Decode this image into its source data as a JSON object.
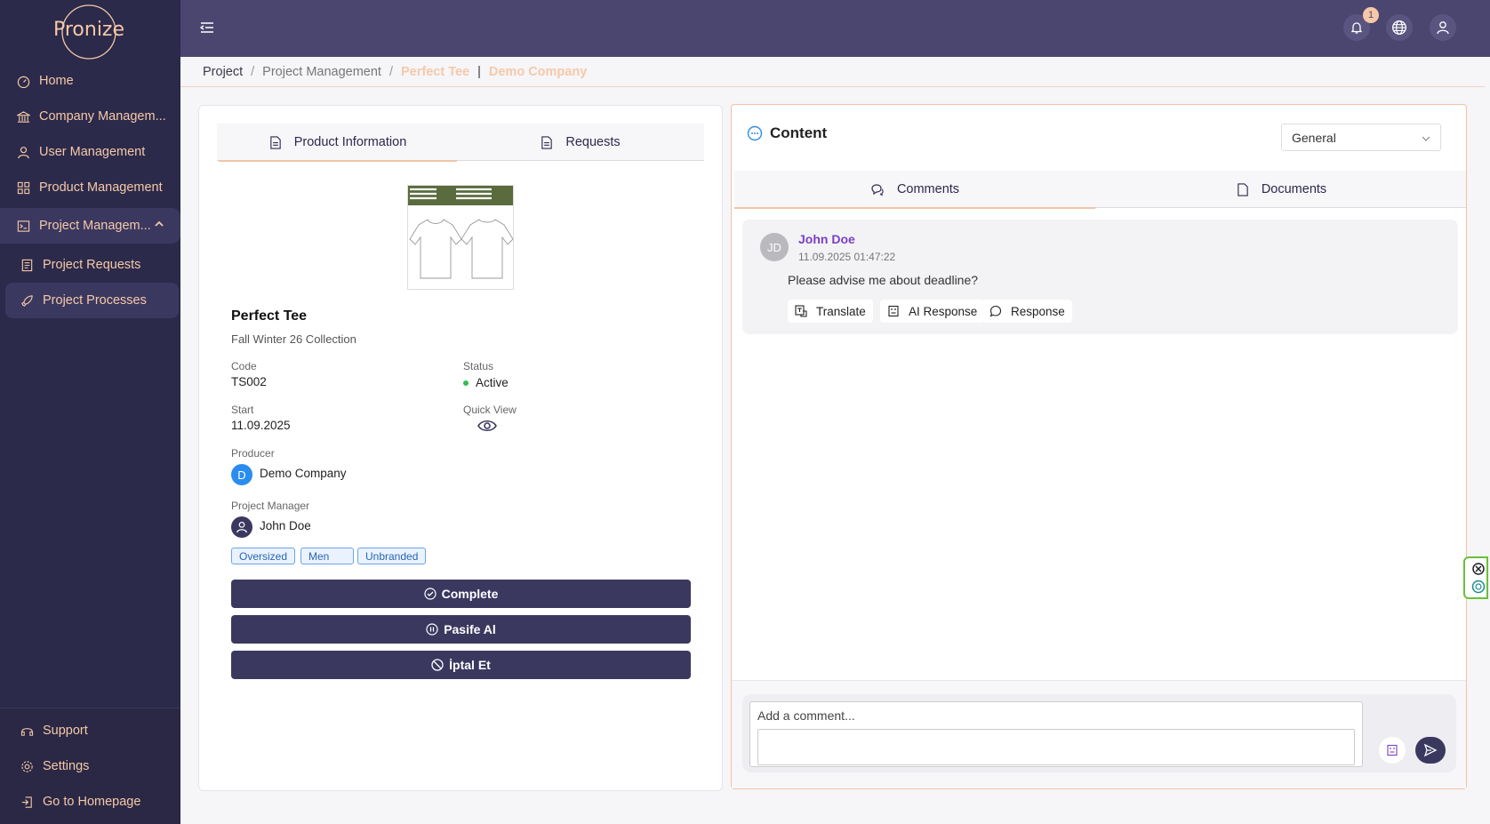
{
  "brand": {
    "logo": "Pronize"
  },
  "sidebar": {
    "items": [
      {
        "label": "Home",
        "icon": "dashboard-icon"
      },
      {
        "label": "Company Managem...",
        "icon": "bank-icon"
      },
      {
        "label": "User Management",
        "icon": "user-icon"
      },
      {
        "label": "Product Management",
        "icon": "grid-icon"
      },
      {
        "label": "Project Managem...",
        "icon": "terminal-icon"
      },
      {
        "label": "Project Requests",
        "icon": "document-icon"
      },
      {
        "label": "Project Processes",
        "icon": "rocket-icon"
      }
    ],
    "bottom": [
      {
        "label": "Support",
        "icon": "headset-icon"
      },
      {
        "label": "Settings",
        "icon": "gear-icon"
      },
      {
        "label": "Go to Homepage",
        "icon": "exit-icon"
      }
    ]
  },
  "header": {
    "notifications_count": "1"
  },
  "breadcrumb": {
    "items": [
      "Project",
      "Project Management",
      "Perfect Tee",
      "Demo Company"
    ],
    "separator": "/",
    "divider": "|"
  },
  "left": {
    "tabs": [
      "Product Information",
      "Requests"
    ],
    "product": {
      "name": "Perfect Tee",
      "collection": "Fall Winter 26 Collection",
      "code_label": "Code",
      "code": "TS002",
      "status_label": "Status",
      "status": "Active",
      "start_label": "Start",
      "start": "11.09.2025",
      "quick_view_label": "Quick View",
      "producer_label": "Producer",
      "producer_initial": "D",
      "producer": "Demo Company",
      "manager_label": "Project Manager",
      "manager": "John Doe",
      "tags": [
        "Oversized",
        "Men",
        "Unbranded"
      ]
    },
    "actions": [
      "Complete",
      "Pasife Al",
      "İptal Et"
    ]
  },
  "right": {
    "title": "Content",
    "select": "General",
    "tabs": [
      "Comments",
      "Documents"
    ],
    "comment": {
      "initials": "JD",
      "author": "John Doe",
      "time": "11.09.2025 01:47:22",
      "text": "Please advise me about deadline?",
      "actions": [
        "Translate",
        "AI Response",
        "Response"
      ]
    },
    "composer": {
      "placeholder": "Add a comment..."
    }
  },
  "colors": {
    "sidebar": "#2c2a4a",
    "header": "#4b4670",
    "accent": "#f5c9a8",
    "primary": "#3b3860"
  }
}
